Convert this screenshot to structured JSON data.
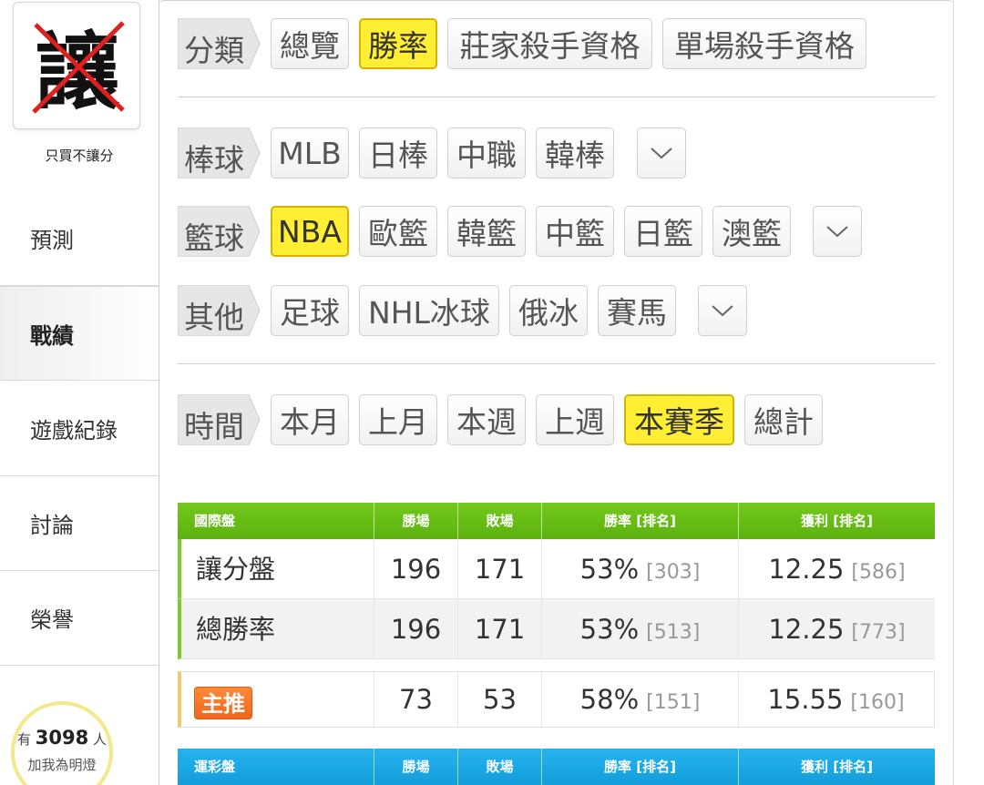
{
  "sidebar": {
    "badge_char": "讓",
    "badge_caption": "只買不讓分",
    "items": [
      {
        "label": "預測"
      },
      {
        "label": "戰績"
      },
      {
        "label": "遊戲紀錄"
      },
      {
        "label": "討論"
      },
      {
        "label": "榮譽"
      }
    ],
    "followers": {
      "prefix": "有",
      "count": "3098",
      "suffix": "人",
      "cta": "加我為明燈"
    }
  },
  "filters": {
    "category": {
      "label": "分類",
      "options": [
        "總覽",
        "勝率",
        "莊家殺手資格",
        "單場殺手資格"
      ],
      "selected": "勝率"
    },
    "baseball": {
      "label": "棒球",
      "options": [
        "MLB",
        "日棒",
        "中職",
        "韓棒"
      ]
    },
    "basketball": {
      "label": "籃球",
      "options": [
        "NBA",
        "歐籃",
        "韓籃",
        "中籃",
        "日籃",
        "澳籃"
      ],
      "selected": "NBA"
    },
    "other": {
      "label": "其他",
      "options": [
        "足球",
        "NHL冰球",
        "俄冰",
        "賽馬"
      ]
    },
    "time": {
      "label": "時間",
      "options": [
        "本月",
        "上月",
        "本週",
        "上週",
        "本賽季",
        "總計"
      ],
      "selected": "本賽季"
    }
  },
  "table_intl": {
    "color": "#66bb11",
    "headers": [
      "國際盤",
      "勝場",
      "敗場",
      "勝率 [排名]",
      "獲利 [排名]"
    ],
    "rows": [
      {
        "name": "讓分盤",
        "wins": "196",
        "losses": "171",
        "rate": "53%",
        "rate_rank": "[303]",
        "profit": "12.25",
        "profit_rank": "[586]"
      },
      {
        "name": "總勝率",
        "wins": "196",
        "losses": "171",
        "rate": "53%",
        "rate_rank": "[513]",
        "profit": "12.25",
        "profit_rank": "[773]"
      }
    ]
  },
  "table_featured": {
    "tag": "主推",
    "wins": "73",
    "losses": "53",
    "rate": "58%",
    "rate_rank": "[151]",
    "profit": "15.55",
    "profit_rank": "[160]"
  },
  "table_sports": {
    "color": "#1aa8e6",
    "headers": [
      "運彩盤",
      "勝場",
      "敗場",
      "勝率 [排名]",
      "獲利 [排名]"
    ]
  }
}
